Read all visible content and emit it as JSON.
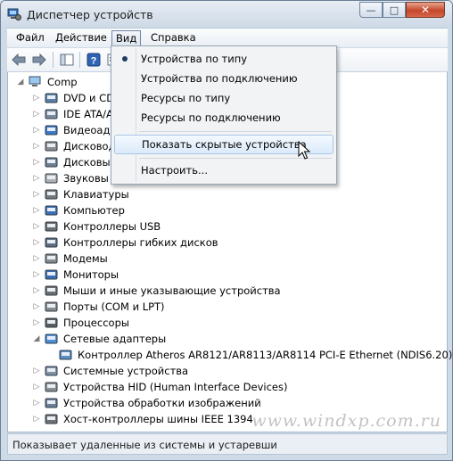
{
  "window": {
    "title": "Диспетчер устройств"
  },
  "menubar": {
    "items": [
      "Файл",
      "Действие",
      "Вид",
      "Справка"
    ],
    "active": "Вид"
  },
  "view_menu": {
    "items": [
      {
        "label": "Устройства по типу",
        "checked": true
      },
      {
        "label": "Устройства по подключению"
      },
      {
        "label": "Ресурсы по типу"
      },
      {
        "label": "Ресурсы по подключению"
      },
      {
        "label": "Показать скрытые устройства",
        "highlighted": true
      },
      {
        "label": "Настроить..."
      }
    ]
  },
  "tree": {
    "root": "Comp",
    "items": [
      {
        "label": "DVD и CD",
        "icon": "dvd-drive-icon"
      },
      {
        "label": "IDE ATA/A",
        "icon": "ide-controller-icon"
      },
      {
        "label": "Видеоада",
        "icon": "video-adapter-icon"
      },
      {
        "label": "Дисковод",
        "icon": "disk-drive-icon"
      },
      {
        "label": "Дисковы",
        "icon": "disk-icon"
      },
      {
        "label": "Звуковы",
        "icon": "sound-device-icon"
      },
      {
        "label": "Клавиатуры",
        "icon": "keyboard-icon"
      },
      {
        "label": "Компьютер",
        "icon": "computer-icon"
      },
      {
        "label": "Контроллеры USB",
        "icon": "usb-icon"
      },
      {
        "label": "Контроллеры гибких дисков",
        "icon": "floppy-controller-icon"
      },
      {
        "label": "Модемы",
        "icon": "modem-icon"
      },
      {
        "label": "Мониторы",
        "icon": "monitor-icon"
      },
      {
        "label": "Мыши и иные указывающие устройства",
        "icon": "mouse-icon"
      },
      {
        "label": "Порты (COM и LPT)",
        "icon": "port-icon"
      },
      {
        "label": "Процессоры",
        "icon": "processor-icon"
      },
      {
        "label": "Сетевые адаптеры",
        "icon": "network-adapter-icon",
        "expanded": true
      },
      {
        "label": "Контроллер Atheros AR8121/AR8113/AR8114 PCI-E Ethernet (NDIS6.20)",
        "icon": "network-card-icon",
        "child": true
      },
      {
        "label": "Системные устройства",
        "icon": "system-device-icon"
      },
      {
        "label": "Устройства HID (Human Interface Devices)",
        "icon": "hid-icon"
      },
      {
        "label": "Устройства обработки изображений",
        "icon": "imaging-device-icon"
      },
      {
        "label": "Хост-контроллеры шины IEEE 1394",
        "icon": "ieee1394-icon"
      }
    ]
  },
  "statusbar": {
    "text": "Показывает удаленные из системы и устаревши"
  },
  "watermark": "www.windxp.com.ru",
  "colors": {
    "menu_bullet": "#1f3a63",
    "close_button": "#c5462b",
    "hover_fill": "#dbeafa"
  }
}
